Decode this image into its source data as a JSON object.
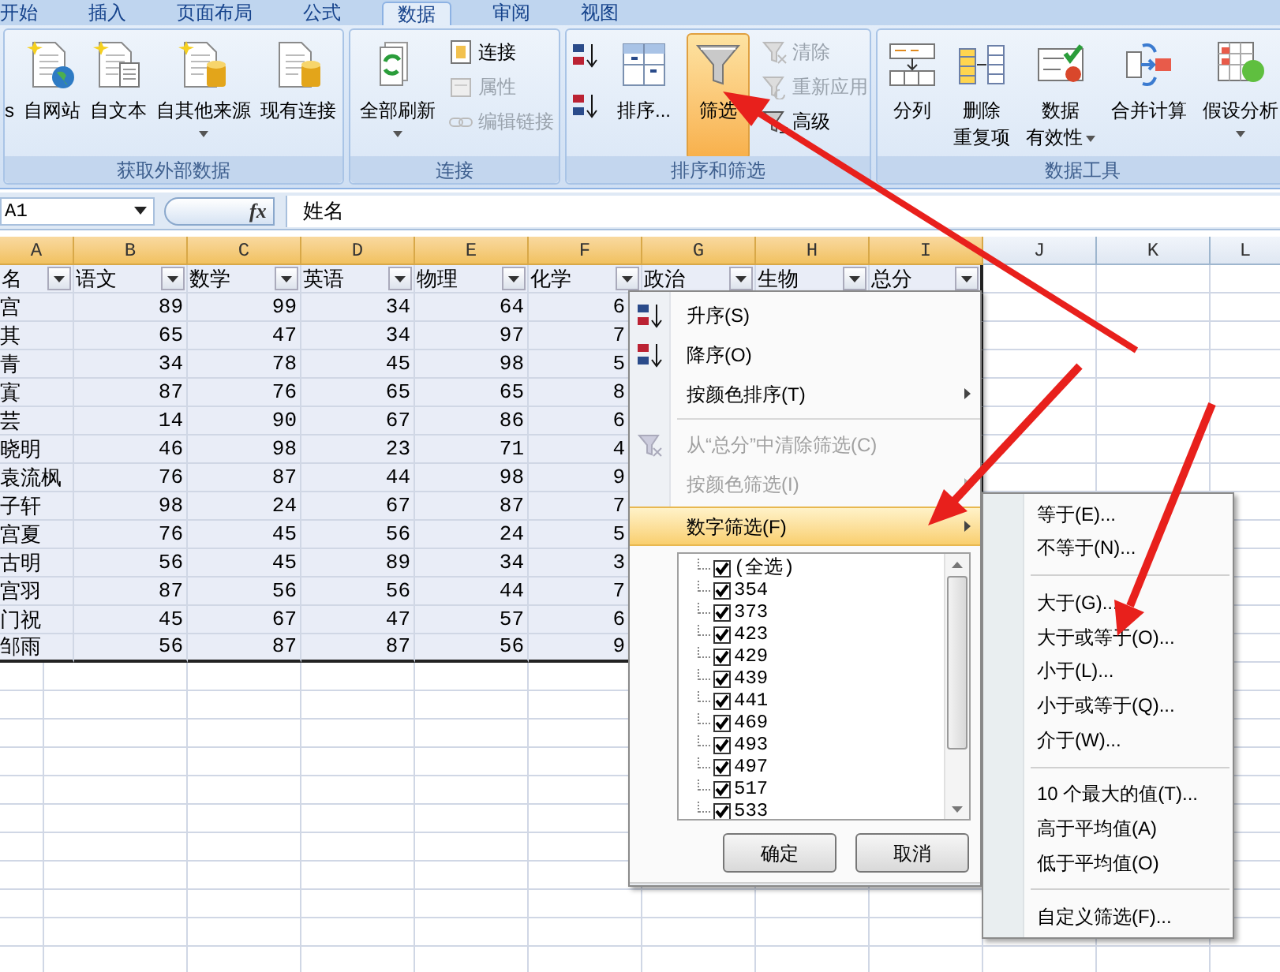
{
  "tabs": [
    {
      "label": "开始",
      "selected": false
    },
    {
      "label": "插入",
      "selected": false
    },
    {
      "label": "页面布局",
      "selected": false
    },
    {
      "label": "公式",
      "selected": false
    },
    {
      "label": "数据",
      "selected": true
    },
    {
      "label": "审阅",
      "selected": false
    },
    {
      "label": "视图",
      "selected": false
    }
  ],
  "ribbon_groups": [
    {
      "label": "获取外部数据",
      "items": [
        {
          "kind": "large",
          "lines": [
            "s"
          ],
          "dropdown": false,
          "on": false,
          "disabled": false
        },
        {
          "kind": "large",
          "lines": [
            "自网站"
          ],
          "dropdown": false,
          "on": false,
          "disabled": false
        },
        {
          "kind": "large",
          "lines": [
            "自文本"
          ],
          "dropdown": false,
          "on": false,
          "disabled": false
        },
        {
          "kind": "large",
          "lines": [
            "自其他来源"
          ],
          "dropdown": true,
          "on": false,
          "disabled": false
        },
        {
          "kind": "large",
          "lines": [
            "现有连接"
          ],
          "dropdown": false,
          "on": false,
          "disabled": false
        }
      ]
    },
    {
      "label": "连接",
      "items": [
        {
          "kind": "large",
          "lines": [
            "全部刷新"
          ],
          "dropdown": true,
          "on": false,
          "disabled": false
        },
        {
          "kind": "small",
          "label": "连接",
          "on": false,
          "disabled": false
        },
        {
          "kind": "small",
          "label": "属性",
          "on": false,
          "disabled": true
        },
        {
          "kind": "small",
          "label": "编辑链接",
          "on": false,
          "disabled": true
        }
      ]
    },
    {
      "label": "排序和筛选",
      "items": [
        {
          "kind": "icon",
          "on": false,
          "disabled": false
        },
        {
          "kind": "icon",
          "on": false,
          "disabled": false
        },
        {
          "kind": "large",
          "lines": [
            "排序..."
          ],
          "dropdown": false,
          "on": false,
          "disabled": false
        },
        {
          "kind": "large",
          "lines": [
            "筛选"
          ],
          "dropdown": false,
          "on": true,
          "disabled": false
        },
        {
          "kind": "small",
          "label": "清除",
          "on": false,
          "disabled": true
        },
        {
          "kind": "small",
          "label": "重新应用",
          "on": false,
          "disabled": true
        },
        {
          "kind": "small",
          "label": "高级",
          "on": false,
          "disabled": false
        }
      ]
    },
    {
      "label": "数据工具",
      "items": [
        {
          "kind": "large",
          "lines": [
            "分列"
          ],
          "dropdown": false,
          "on": false,
          "disabled": false
        },
        {
          "kind": "large",
          "lines": [
            "删除",
            "重复项"
          ],
          "dropdown": false,
          "on": false,
          "disabled": false
        },
        {
          "kind": "large",
          "lines": [
            "数据",
            "有效性"
          ],
          "dropdown": true,
          "on": false,
          "disabled": false
        },
        {
          "kind": "large",
          "lines": [
            "合并计算"
          ],
          "dropdown": false,
          "on": false,
          "disabled": false
        },
        {
          "kind": "large",
          "lines": [
            "假设分析"
          ],
          "dropdown": true,
          "on": false,
          "disabled": false
        }
      ]
    }
  ],
  "formula_bar": {
    "name_box": "A1",
    "function_label": "fx",
    "formula": "姓名"
  },
  "sheet": {
    "columns": [
      {
        "label": "A",
        "selected": true
      },
      {
        "label": "B",
        "selected": true
      },
      {
        "label": "C",
        "selected": true
      },
      {
        "label": "D",
        "selected": true
      },
      {
        "label": "E",
        "selected": true
      },
      {
        "label": "F",
        "selected": true
      },
      {
        "label": "G",
        "selected": true
      },
      {
        "label": "H",
        "selected": true
      },
      {
        "label": "I",
        "selected": true
      },
      {
        "label": "J",
        "selected": false
      },
      {
        "label": "K",
        "selected": false
      },
      {
        "label": "L",
        "selected": false
      }
    ],
    "header_row": [
      "名",
      "语文",
      "数学",
      "英语",
      "物理",
      "化学",
      "政治",
      "生物",
      "总分"
    ],
    "rows": [
      [
        "宫",
        "89",
        "99",
        "34",
        "64",
        "6"
      ],
      [
        "其",
        "65",
        "47",
        "34",
        "97",
        "7"
      ],
      [
        "青",
        "34",
        "78",
        "45",
        "98",
        "5"
      ],
      [
        "寘",
        "87",
        "76",
        "65",
        "65",
        "8"
      ],
      [
        "芸",
        "14",
        "90",
        "67",
        "86",
        "6"
      ],
      [
        "晓明",
        "46",
        "98",
        "23",
        "71",
        "4"
      ],
      [
        "袁流枫",
        "76",
        "87",
        "44",
        "98",
        "9"
      ],
      [
        "子轩",
        "98",
        "24",
        "67",
        "87",
        "7"
      ],
      [
        "宫夏",
        "76",
        "45",
        "56",
        "24",
        "5"
      ],
      [
        "古明",
        "56",
        "45",
        "89",
        "34",
        "3"
      ],
      [
        "宫羽",
        "87",
        "56",
        "56",
        "44",
        "7"
      ],
      [
        "门祝",
        "45",
        "67",
        "47",
        "57",
        "6"
      ],
      [
        "邹雨",
        "56",
        "87",
        "87",
        "56",
        "9"
      ]
    ]
  },
  "filter_menu": {
    "items": [
      {
        "kind": "item",
        "label": "升序(S)",
        "disabled": false,
        "submenu": false,
        "selected": false
      },
      {
        "kind": "item",
        "label": "降序(O)",
        "disabled": false,
        "submenu": false,
        "selected": false
      },
      {
        "kind": "item",
        "label": "按颜色排序(T)",
        "disabled": false,
        "submenu": true,
        "selected": false
      },
      {
        "kind": "separator"
      },
      {
        "kind": "item",
        "label": "从“总分”中清除筛选(C)",
        "disabled": true,
        "submenu": false,
        "selected": false
      },
      {
        "kind": "item",
        "label": "按颜色筛选(I)",
        "disabled": true,
        "submenu": true,
        "selected": false
      },
      {
        "kind": "item",
        "label": "数字筛选(F)",
        "disabled": false,
        "submenu": true,
        "selected": true
      }
    ],
    "values": [
      {
        "label": "(全选)",
        "checked": true
      },
      {
        "label": "354",
        "checked": true
      },
      {
        "label": "373",
        "checked": true
      },
      {
        "label": "423",
        "checked": true
      },
      {
        "label": "429",
        "checked": true
      },
      {
        "label": "439",
        "checked": true
      },
      {
        "label": "441",
        "checked": true
      },
      {
        "label": "469",
        "checked": true
      },
      {
        "label": "493",
        "checked": true
      },
      {
        "label": "497",
        "checked": true
      },
      {
        "label": "517",
        "checked": true
      },
      {
        "label": "533",
        "checked": true
      }
    ],
    "buttons": [
      "确定",
      "取消"
    ]
  },
  "submenu": [
    {
      "kind": "item",
      "label": "等于(E)..."
    },
    {
      "kind": "item",
      "label": "不等于(N)..."
    },
    {
      "kind": "separator"
    },
    {
      "kind": "item",
      "label": "大于(G)..."
    },
    {
      "kind": "item",
      "label": "大于或等于(O)..."
    },
    {
      "kind": "item",
      "label": "小于(L)..."
    },
    {
      "kind": "item",
      "label": "小于或等于(Q)..."
    },
    {
      "kind": "item",
      "label": "介于(W)..."
    },
    {
      "kind": "separator"
    },
    {
      "kind": "item",
      "label": "10 个最大的值(T)..."
    },
    {
      "kind": "item",
      "label": "高于平均值(A)"
    },
    {
      "kind": "item",
      "label": "低于平均值(O)"
    },
    {
      "kind": "separator"
    },
    {
      "kind": "item",
      "label": "自定义筛选(F)..."
    }
  ]
}
